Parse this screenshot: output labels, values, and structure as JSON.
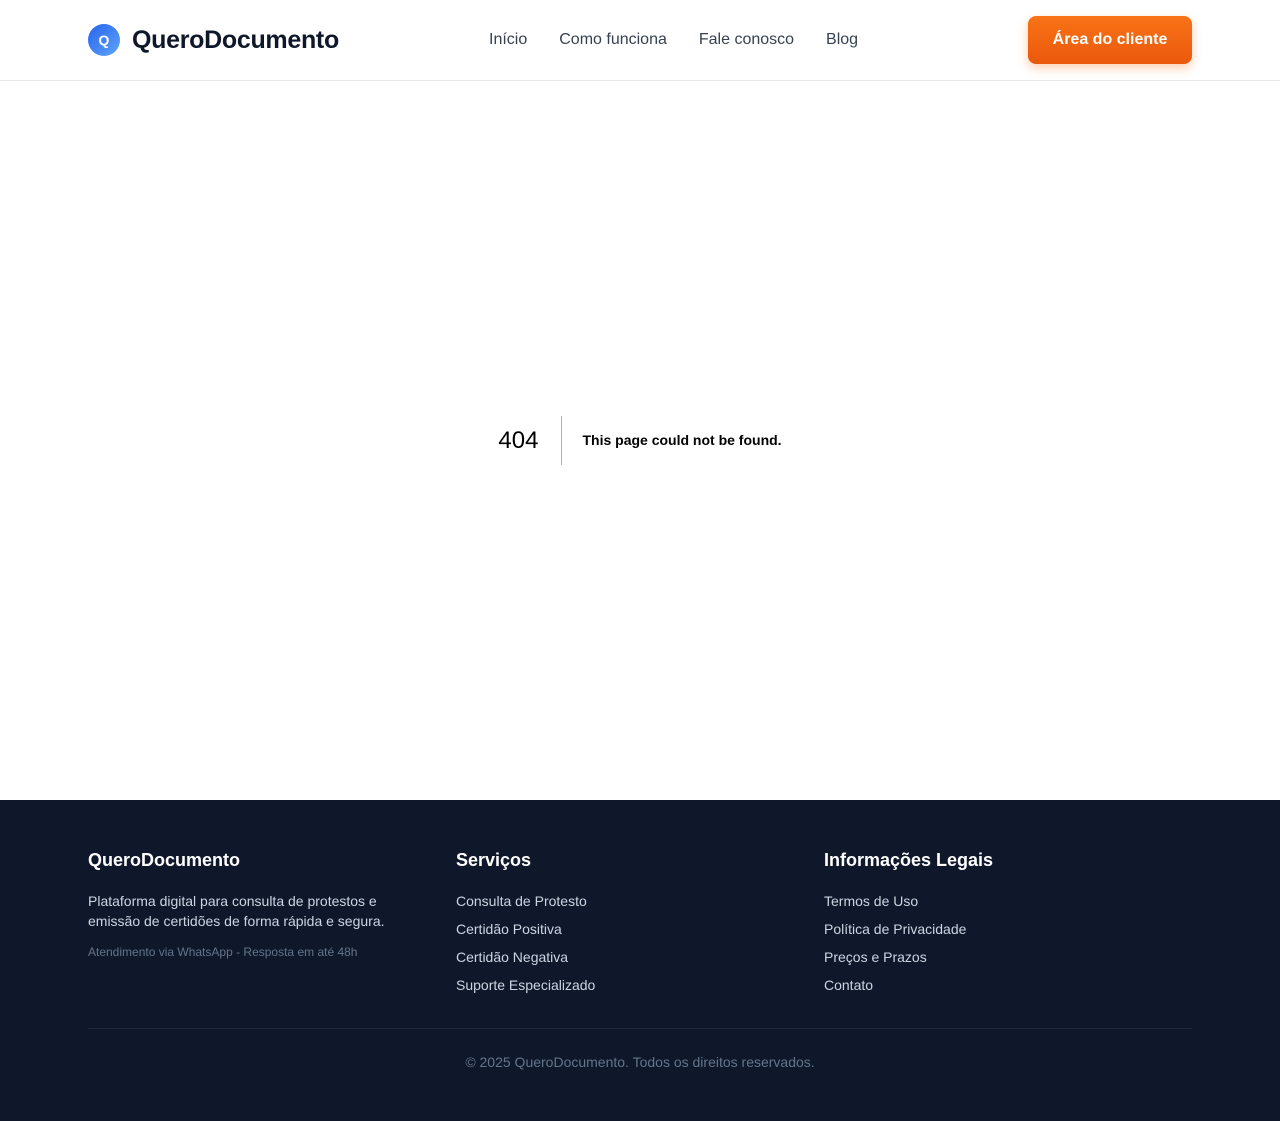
{
  "header": {
    "logo_letter": "Q",
    "brand": "QueroDocumento",
    "nav": [
      "Início",
      "Como funciona",
      "Fale conosco",
      "Blog"
    ],
    "cta_label": "Área do cliente"
  },
  "error": {
    "code": "404",
    "message": "This page could not be found."
  },
  "footer": {
    "about": {
      "title": "QueroDocumento",
      "description": "Plataforma digital para consulta de protestos e emissão de certidões de forma rápida e segura.",
      "note": "Atendimento via WhatsApp - Resposta em até 48h"
    },
    "services": {
      "title": "Serviços",
      "items": [
        "Consulta de Protesto",
        "Certidão Positiva",
        "Certidão Negativa",
        "Suporte Especializado"
      ]
    },
    "legal": {
      "title": "Informações Legais",
      "items": [
        "Termos de Uso",
        "Política de Privacidade",
        "Preços e Prazos",
        "Contato"
      ]
    },
    "copyright": "© 2025 QueroDocumento. Todos os direitos reservados."
  },
  "colors": {
    "accent": "#f97316",
    "brand_blue": "#2563eb",
    "footer_bg": "#0f172a"
  }
}
